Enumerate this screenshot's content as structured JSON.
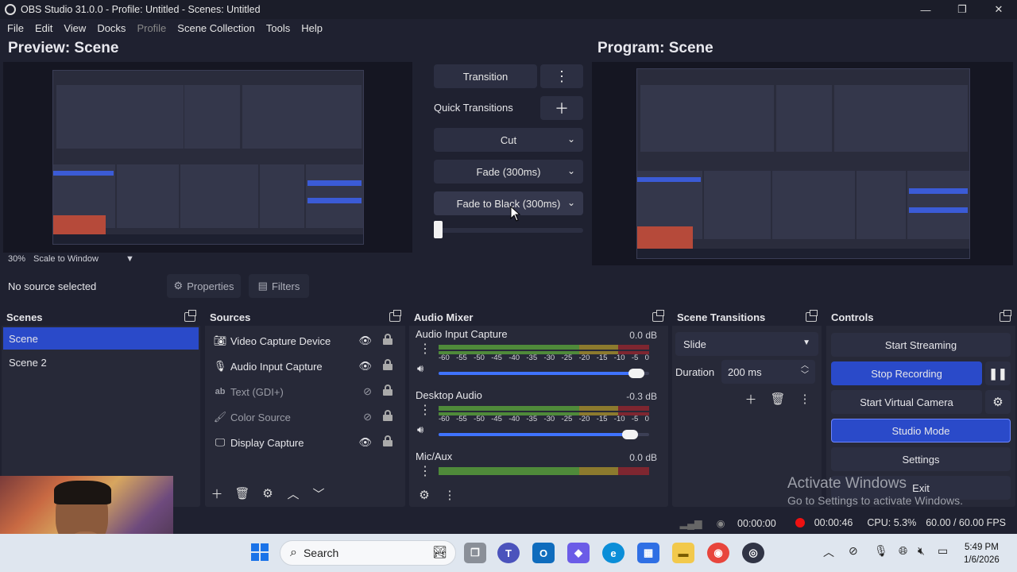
{
  "window": {
    "title": "OBS Studio 31.0.0 - Profile: Untitled - Scenes: Untitled",
    "controls": [
      "—",
      "❐",
      "✕"
    ]
  },
  "menu": [
    "File",
    "Edit",
    "View",
    "Docks",
    "Profile",
    "Scene Collection",
    "Tools",
    "Help"
  ],
  "preview": {
    "title": "Preview: Scene",
    "zoom": "30%",
    "scale_mode": "Scale to Window"
  },
  "program": {
    "title": "Program: Scene"
  },
  "transitions": {
    "transition_label": "Transition",
    "quick_label": "Quick Transitions",
    "items": [
      "Cut",
      "Fade (300ms)",
      "Fade to Black (300ms)"
    ]
  },
  "source_bar": {
    "no_source": "No source selected",
    "properties": "Properties",
    "filters": "Filters"
  },
  "scenes": {
    "title": "Scenes",
    "items": [
      "Scene",
      "Scene 2"
    ]
  },
  "sources": {
    "title": "Sources",
    "items": [
      {
        "label": "Video Capture Device",
        "icon": "camera-icon",
        "visible": true
      },
      {
        "label": "Audio Input Capture",
        "icon": "microphone-icon",
        "visible": true
      },
      {
        "label": "Text (GDI+)",
        "icon": "text-icon",
        "visible": false
      },
      {
        "label": "Color Source",
        "icon": "brush-icon",
        "visible": false
      },
      {
        "label": "Display Capture",
        "icon": "monitor-icon",
        "visible": true
      }
    ]
  },
  "mixer": {
    "title": "Audio Mixer",
    "channels": [
      {
        "name": "Audio Input Capture",
        "db": "0.0 dB",
        "volume": 1.0
      },
      {
        "name": "Desktop Audio",
        "db": "-0.3 dB",
        "volume": 0.97
      },
      {
        "name": "Mic/Aux",
        "db": "0.0 dB",
        "volume": 1.0
      }
    ],
    "scale": [
      "-60",
      "-55",
      "-50",
      "-45",
      "-40",
      "-35",
      "-30",
      "-25",
      "-20",
      "-15",
      "-10",
      "-5",
      "0"
    ]
  },
  "scene_transitions": {
    "title": "Scene Transitions",
    "selected": "Slide",
    "duration_label": "Duration",
    "duration": "200 ms"
  },
  "controls": {
    "title": "Controls",
    "start_streaming": "Start Streaming",
    "stop_recording": "Stop Recording",
    "start_virtual_camera": "Start Virtual Camera",
    "studio_mode": "Studio Mode",
    "settings": "Settings",
    "exit": "Exit"
  },
  "status": {
    "stream_time": "00:00:00",
    "rec_time": "00:00:46",
    "cpu": "CPU: 5.3%",
    "fps": "60.00 / 60.00 FPS"
  },
  "activate": {
    "line1": "Activate Windows",
    "line2": "Go to Settings to activate Windows."
  },
  "taskbar": {
    "search": "Search",
    "time": "5:49 PM",
    "date": "1/6/2026"
  },
  "colors": {
    "accent": "#2a4ac9",
    "panel": "#272938",
    "background": "#1f2130",
    "record": "#e11111"
  }
}
